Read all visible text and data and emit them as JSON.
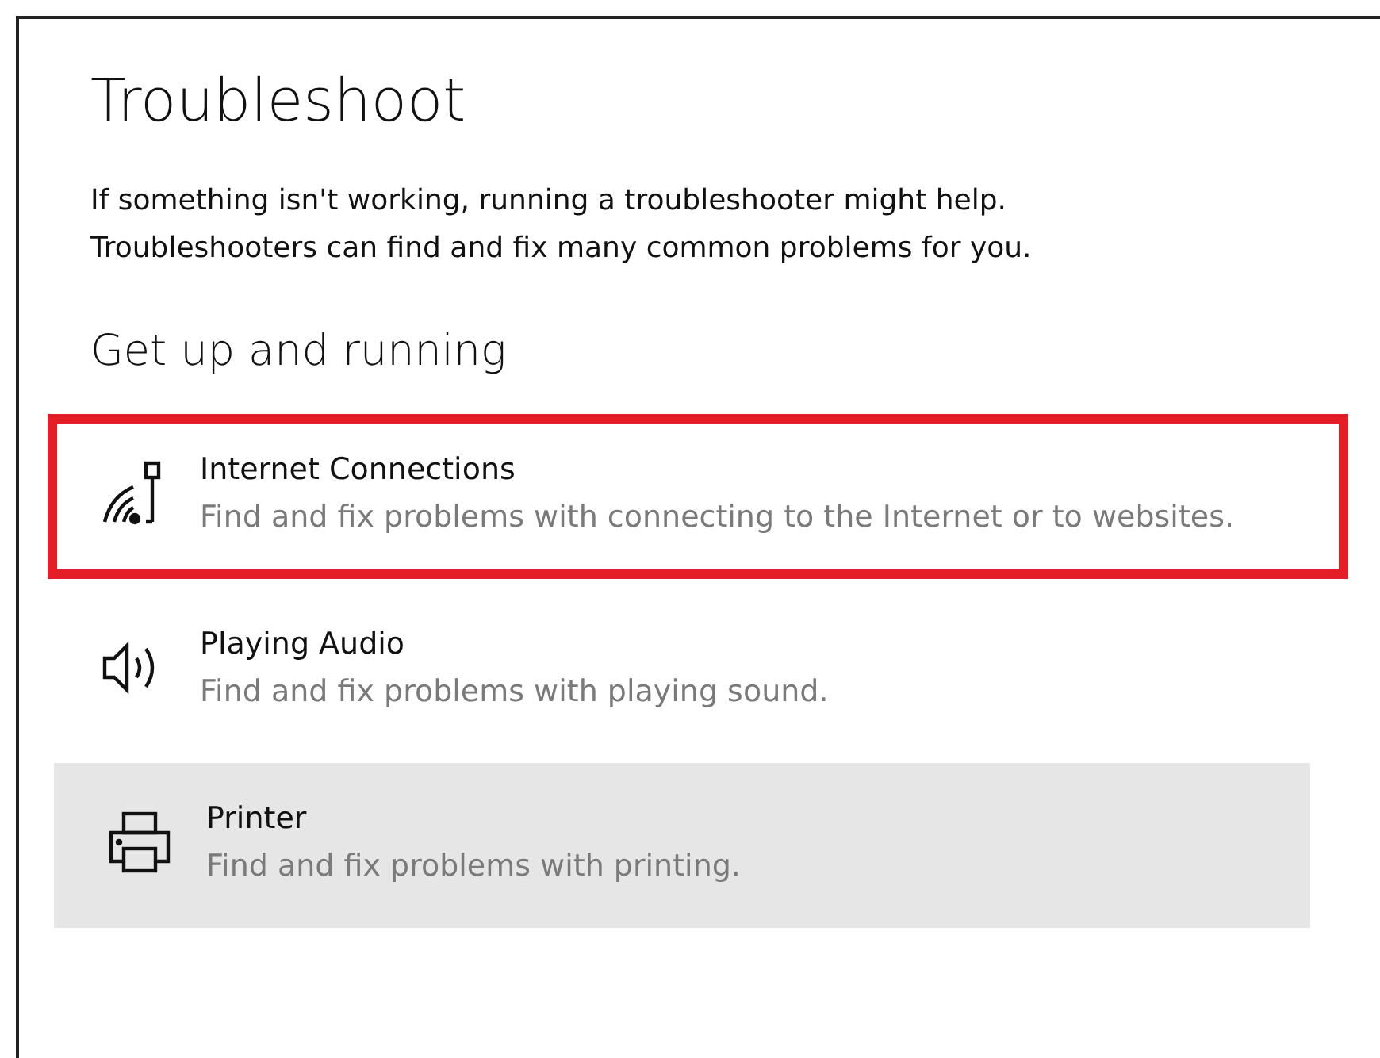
{
  "title": "Troubleshoot",
  "description": [
    "If something isn't working, running a troubleshooter might help.",
    "Troubleshooters can find and fix many common problems for you."
  ],
  "section": "Get up and running",
  "items": [
    {
      "kind": "internet",
      "title": "Internet Connections",
      "subtitle": "Find and fix problems with connecting to the Internet or to websites.",
      "outlined": true,
      "hovered": false
    },
    {
      "kind": "audio",
      "title": "Playing Audio",
      "subtitle": "Find and fix problems with playing sound.",
      "outlined": false,
      "hovered": false
    },
    {
      "kind": "printer",
      "title": "Printer",
      "subtitle": "Find and fix problems with printing.",
      "outlined": false,
      "hovered": true
    }
  ]
}
